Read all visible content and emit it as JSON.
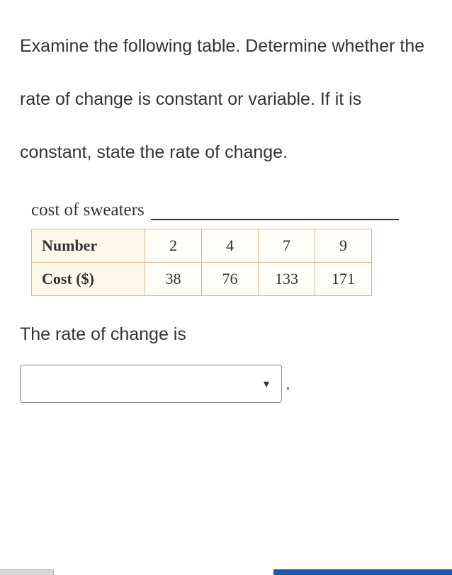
{
  "question": {
    "text": "Examine the following table. Determine whether the rate of change is constant or variable. If it is constant, state the rate of change."
  },
  "table": {
    "title": "cost of sweaters",
    "rows": [
      {
        "label": "Number",
        "values": [
          "2",
          "4",
          "7",
          "9"
        ]
      },
      {
        "label": "Cost ($)",
        "values": [
          "38",
          "76",
          "133",
          "171"
        ]
      }
    ]
  },
  "answer": {
    "prompt": "The rate of change is",
    "period": "."
  },
  "chart_data": {
    "type": "table",
    "title": "cost of sweaters",
    "columns": [
      "Number",
      "Cost ($)"
    ],
    "data": [
      {
        "Number": 2,
        "Cost ($)": 38
      },
      {
        "Number": 4,
        "Cost ($)": 76
      },
      {
        "Number": 7,
        "Cost ($)": 133
      },
      {
        "Number": 9,
        "Cost ($)": 171
      }
    ]
  }
}
